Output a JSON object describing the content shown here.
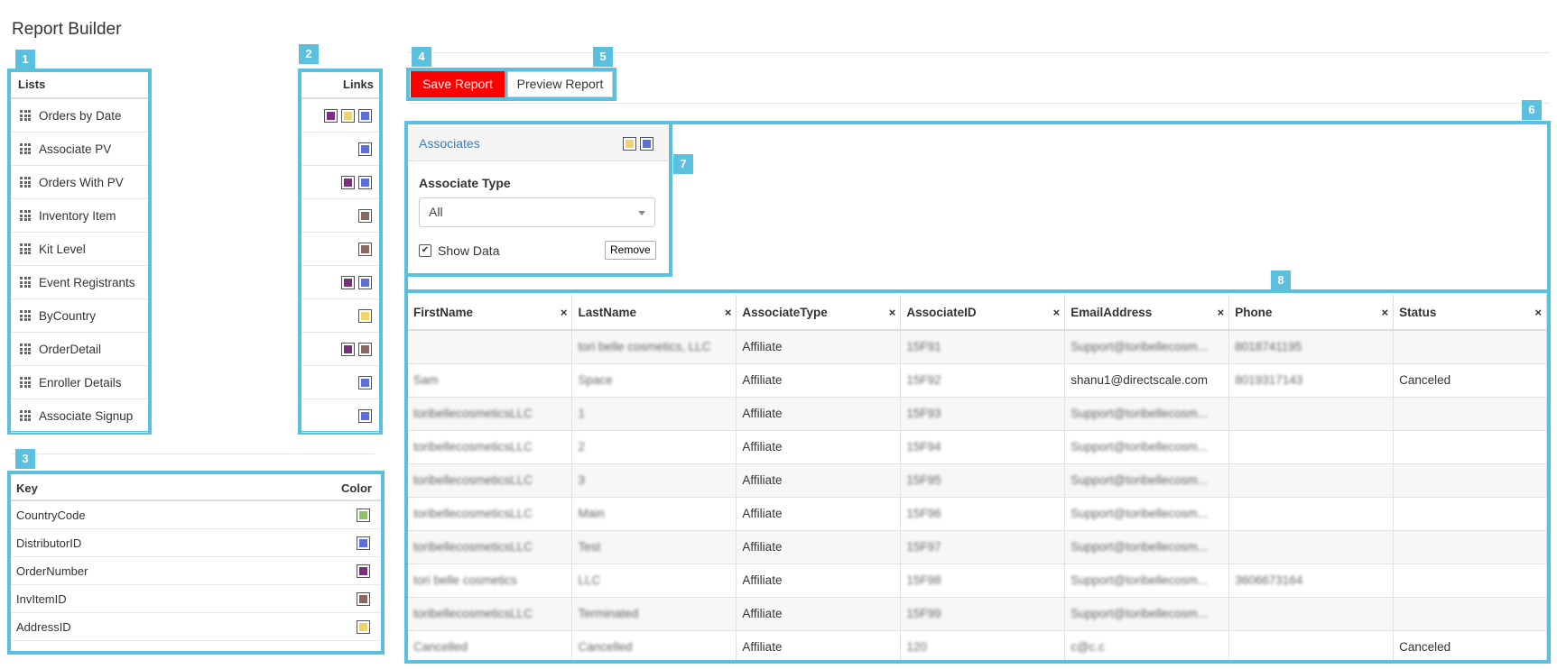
{
  "page_title": "Report Builder",
  "callouts": [
    "1",
    "2",
    "3",
    "4",
    "5",
    "6",
    "7",
    "8"
  ],
  "colors": {
    "highlight": "#5bc0de",
    "green": "#8fc16d",
    "blue": "#5b6fd6",
    "purple": "#7a2f7e",
    "brown": "#8a6860",
    "yellow": "#f0d36a",
    "save_button": "#ff0000"
  },
  "lists": {
    "header": "Lists",
    "items": [
      {
        "label": "Orders by Date",
        "links": [
          "purple",
          "yellow",
          "blue"
        ]
      },
      {
        "label": "Associate PV",
        "links": [
          "blue"
        ]
      },
      {
        "label": "Orders With PV",
        "links": [
          "purple",
          "blue"
        ]
      },
      {
        "label": "Inventory Item",
        "links": [
          "brown"
        ]
      },
      {
        "label": "Kit Level",
        "links": [
          "brown"
        ]
      },
      {
        "label": "Event Registrants",
        "links": [
          "purple",
          "blue"
        ]
      },
      {
        "label": "ByCountry",
        "links": [
          "yellow"
        ]
      },
      {
        "label": "OrderDetail",
        "links": [
          "purple",
          "brown"
        ]
      },
      {
        "label": "Enroller Details",
        "links": [
          "blue"
        ]
      },
      {
        "label": "Associate Signup",
        "links": [
          "blue"
        ]
      }
    ]
  },
  "links_header": "Links",
  "key": {
    "header_key": "Key",
    "header_color": "Color",
    "rows": [
      {
        "key": "CountryCode",
        "color": "green"
      },
      {
        "key": "DistributorID",
        "color": "blue"
      },
      {
        "key": "OrderNumber",
        "color": "purple"
      },
      {
        "key": "InvItemID",
        "color": "brown"
      },
      {
        "key": "AddressID",
        "color": "yellow"
      }
    ]
  },
  "toolbar": {
    "save_label": "Save Report",
    "preview_label": "Preview Report"
  },
  "associates_panel": {
    "title": "Associates",
    "links": [
      "yellow",
      "blue"
    ],
    "field_label": "Associate Type",
    "select_value": "All",
    "show_data_label": "Show Data",
    "show_data_checked": true,
    "remove_label": "Remove"
  },
  "table": {
    "columns": [
      "FirstName",
      "LastName",
      "AssociateType",
      "AssociateID",
      "EmailAddress",
      "Phone",
      "Status"
    ],
    "close_glyph": "×",
    "rows": [
      [
        "",
        "tori belle cosmetics, LLC",
        "Affiliate",
        "15F91",
        "Support@toribellecosm...",
        "8018741195",
        ""
      ],
      [
        "Sam",
        "Space",
        "Affiliate",
        "15F92",
        "shanu1@directscale.com",
        "8019317143",
        "Canceled"
      ],
      [
        "toribellecosmeticsLLC",
        "1",
        "Affiliate",
        "15F93",
        "Support@toribellecosm...",
        "",
        ""
      ],
      [
        "toribellecosmeticsLLC",
        "2",
        "Affiliate",
        "15F94",
        "Support@toribellecosm...",
        "",
        ""
      ],
      [
        "toribellecosmeticsLLC",
        "3",
        "Affiliate",
        "15F95",
        "Support@toribellecosm...",
        "",
        ""
      ],
      [
        "toribellecosmeticsLLC",
        "Main",
        "Affiliate",
        "15F96",
        "Support@toribellecosm...",
        "",
        ""
      ],
      [
        "toribellecosmeticsLLC",
        "Test",
        "Affiliate",
        "15F97",
        "Support@toribellecosm...",
        "",
        ""
      ],
      [
        "tori belle cosmetics",
        "LLC",
        "Affiliate",
        "15F98",
        "Support@toribellecosm...",
        "3606673164",
        ""
      ],
      [
        "toribellecosmeticsLLC",
        "Terminated",
        "Affiliate",
        "15F99",
        "Support@toribellecosm...",
        "",
        ""
      ],
      [
        "Cancelled",
        "Cancelled",
        "Affiliate",
        "120",
        "c@c.c",
        "",
        "Canceled"
      ]
    ]
  }
}
